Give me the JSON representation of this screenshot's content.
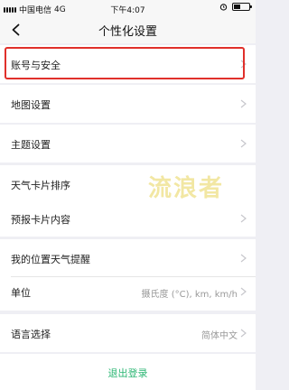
{
  "status_bar": {
    "carrier": "中国电信",
    "network": "4G",
    "time": "下午4:07",
    "battery_level": 0.45
  },
  "nav": {
    "title": "个性化设置",
    "back_icon": "chevron-left-icon"
  },
  "settings": {
    "account_security": "账号与安全",
    "map_settings": "地图设置",
    "theme_settings": "主题设置",
    "weather_card_order": "天气卡片排序",
    "forecast_card_content": "预报卡片内容",
    "location_weather_alert": "我的位置天气提醒",
    "units_label": "单位",
    "units_value": "摄氏度 (°C), km, km/h",
    "language_label": "语言选择",
    "language_value": "简体中文"
  },
  "logout_label": "退出登录",
  "watermark_text": "流浪者",
  "colors": {
    "accent_green": "#2bb673",
    "highlight_red": "#e0302b",
    "background": "#efeff4"
  }
}
